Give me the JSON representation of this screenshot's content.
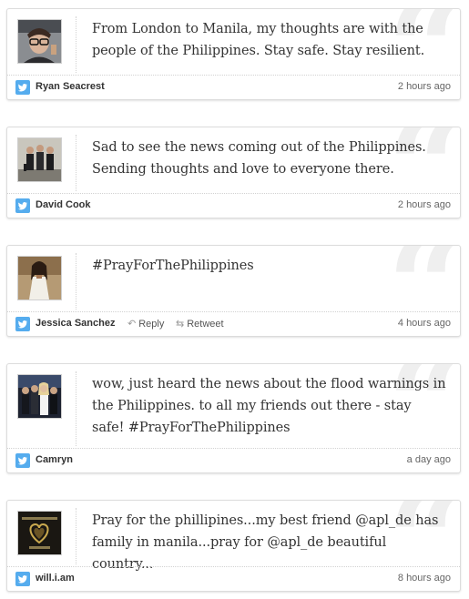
{
  "tweets": [
    {
      "text": "From London to Manila, my thoughts are with the people of the Philippines. Stay safe. Stay resilient.",
      "author": "Ryan Seacrest",
      "time": "2 hours ago"
    },
    {
      "text": "Sad to see the news coming out of the Philippines. Sending thoughts and love to everyone there.",
      "author": "David Cook",
      "time": "2 hours ago"
    },
    {
      "text": "#PrayForThePhilippines",
      "author": "Jessica Sanchez",
      "time": "4 hours ago",
      "reply_label": "Reply",
      "retweet_label": "Retweet"
    },
    {
      "text": "wow, just heard the news about the flood warnings in the Philippines. to all my friends out there - stay safe! #PrayForThePhilippines",
      "author": "Camryn",
      "time": "a day ago"
    },
    {
      "text": "Pray for the phillipines...my best friend @apl_de has family in manila...pray for @apl_de beautiful country...",
      "author": "will.i.am",
      "time": "8 hours ago"
    }
  ],
  "icons": {
    "quote": "quote-mark-icon",
    "bird": "twitter-bird-icon",
    "reply": "reply-arrow-icon",
    "retweet": "retweet-icon"
  },
  "colors": {
    "twitter_blue": "#55acee",
    "text": "#333333",
    "border": "#dcdcdc"
  }
}
